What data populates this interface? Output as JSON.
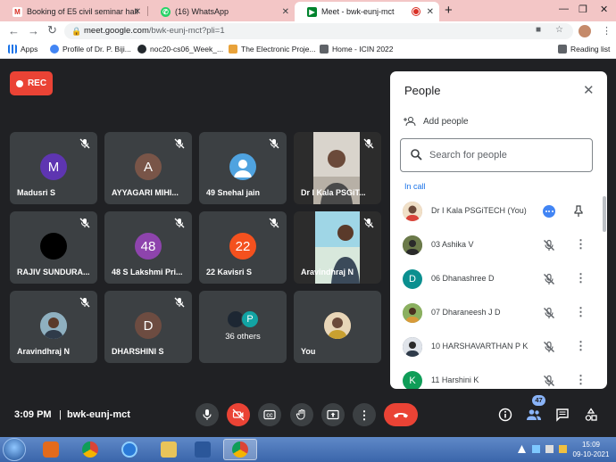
{
  "browser": {
    "tabs": [
      {
        "title": "Booking of E5 civil seminar hall",
        "favicon": "gmail-icon",
        "color": "#d93025"
      },
      {
        "title": "(16) WhatsApp",
        "favicon": "whatsapp-icon",
        "color": "#25d366"
      },
      {
        "title": "Meet - bwk-eunj-mct",
        "favicon": "meet-icon",
        "color": "#00832d",
        "active": true
      }
    ],
    "new_tab": "+",
    "url_host": "meet.google.com",
    "url_path": "/bwk-eunj-mct?pli=1",
    "bookmarks": [
      {
        "label": "Apps",
        "icon": "apps-grid-icon"
      },
      {
        "label": "Profile of Dr. P. Biji...",
        "icon": "globe-icon"
      },
      {
        "label": "noc20-cs06_Week_...",
        "icon": "github-icon"
      },
      {
        "label": "The Electronic Proje...",
        "icon": "electronics-icon"
      },
      {
        "label": "Home - ICIN 2022",
        "icon": "doc-icon"
      }
    ],
    "reading_list": "Reading list"
  },
  "meet": {
    "rec_label": "REC",
    "tiles": [
      {
        "name": "Madusri S",
        "initial": "M",
        "color": "#5e35b1",
        "type": "avatar"
      },
      {
        "name": "AYYAGARI MIHI...",
        "initial": "A",
        "color": "#795548",
        "type": "avatar"
      },
      {
        "name": "49 Snehal jain",
        "initial": "",
        "color": "#4fa3e0",
        "type": "person-avatar"
      },
      {
        "name": "Dr I Kala PSGiT...",
        "type": "video"
      },
      {
        "name": "RAJIV SUNDURA...",
        "initial": "",
        "color": "#000000",
        "type": "avatar"
      },
      {
        "name": "48 S Lakshmi Pri...",
        "initial": "48",
        "color": "#8e44ad",
        "type": "avatar"
      },
      {
        "name": "22 Kavisri S",
        "initial": "22",
        "color": "#f4511e",
        "type": "avatar"
      },
      {
        "name": "Aravindhraj N",
        "type": "video"
      },
      {
        "name": "Aravindhraj N",
        "initial": "",
        "color": "#6d8a9a",
        "type": "photo-avatar"
      },
      {
        "name": "DHARSHINI S",
        "initial": "D",
        "color": "#6d4c41",
        "type": "avatar"
      },
      {
        "name": "36 others",
        "type": "others"
      },
      {
        "name": "You",
        "initial": "",
        "color": "#c79a6a",
        "type": "photo-avatar"
      }
    ],
    "others_bubble": "P",
    "time": "3:09 PM",
    "separator": "|",
    "meeting_code": "bwk-eunj-mct",
    "participant_count": "47"
  },
  "people_panel": {
    "title": "People",
    "add_people": "Add people",
    "search_placeholder": "Search for people",
    "in_call": "In call",
    "participants": [
      {
        "name": "Dr I Kala PSGiTECH (You)",
        "initial": "",
        "color": "#c98a6a",
        "self": true
      },
      {
        "name": "03 Ashika V",
        "initial": "",
        "color": "#5a6b3a"
      },
      {
        "name": "06 Dhanashree D",
        "initial": "D",
        "color": "#0b8f8f"
      },
      {
        "name": "07 Dharaneesh J D",
        "initial": "",
        "color": "#7ea15a"
      },
      {
        "name": "10 HARSHAVARTHAN P K",
        "initial": "",
        "color": "#3d4a5c"
      },
      {
        "name": "11 Harshini K",
        "initial": "K",
        "color": "#0f9d58"
      }
    ]
  },
  "taskbar": {
    "clock_time": "15:09",
    "clock_date": "09-10-2021"
  }
}
